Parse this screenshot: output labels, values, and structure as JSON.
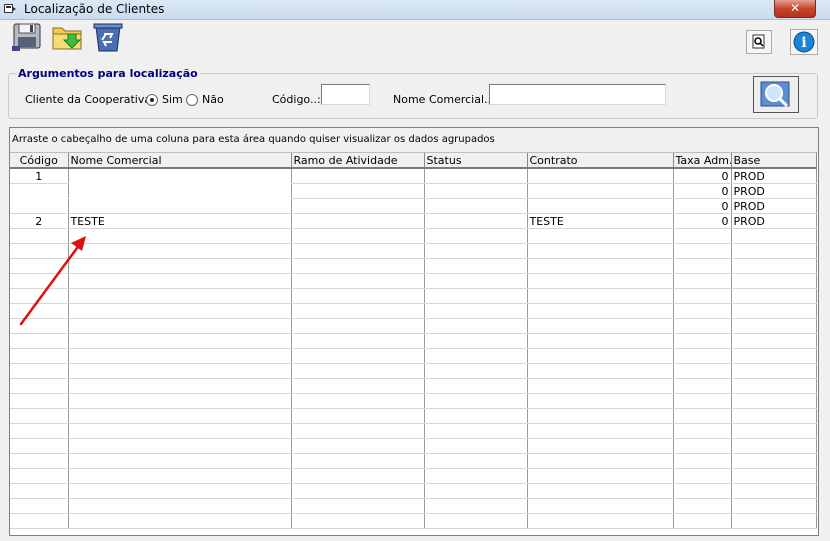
{
  "window": {
    "title": "Localização de Clientes",
    "close_label": "✕"
  },
  "toolbar": {
    "buttons": [
      "save-icon",
      "export-folder-icon",
      "recycle-bin-icon"
    ],
    "right_buttons": [
      "print-preview-icon",
      "info-icon"
    ],
    "info_label": "i"
  },
  "filters": {
    "group_title": "Argumentos para localização",
    "cooperativa_label": "Cliente da Cooperativa?",
    "sim_label": "Sim",
    "nao_label": "Não",
    "selected": "Sim",
    "codigo_label": "Código..:",
    "codigo_value": "",
    "nome_label": "Nome Comercial..:",
    "nome_value": ""
  },
  "grid": {
    "group_hint": "Arraste o cabeçalho de uma coluna para esta área quando quiser visualizar os dados agrupados",
    "columns": [
      "Código",
      "Nome Comercial",
      "Ramo de Atividade",
      "Status",
      "Contrato",
      "Taxa Adm.",
      "Base"
    ],
    "rows": [
      [
        "1",
        "",
        "",
        "",
        "",
        "0",
        "PROD"
      ],
      [
        "",
        "",
        "",
        "",
        "",
        "0",
        "PROD"
      ],
      [
        "",
        "",
        "",
        "",
        "",
        "0",
        "PROD"
      ],
      [
        "2",
        "TESTE",
        "",
        "",
        "TESTE",
        "0",
        "PROD"
      ]
    ],
    "empty_rows": 20
  },
  "colors": {
    "annotation_arrow": "#e01010",
    "group_title": "#000080"
  }
}
